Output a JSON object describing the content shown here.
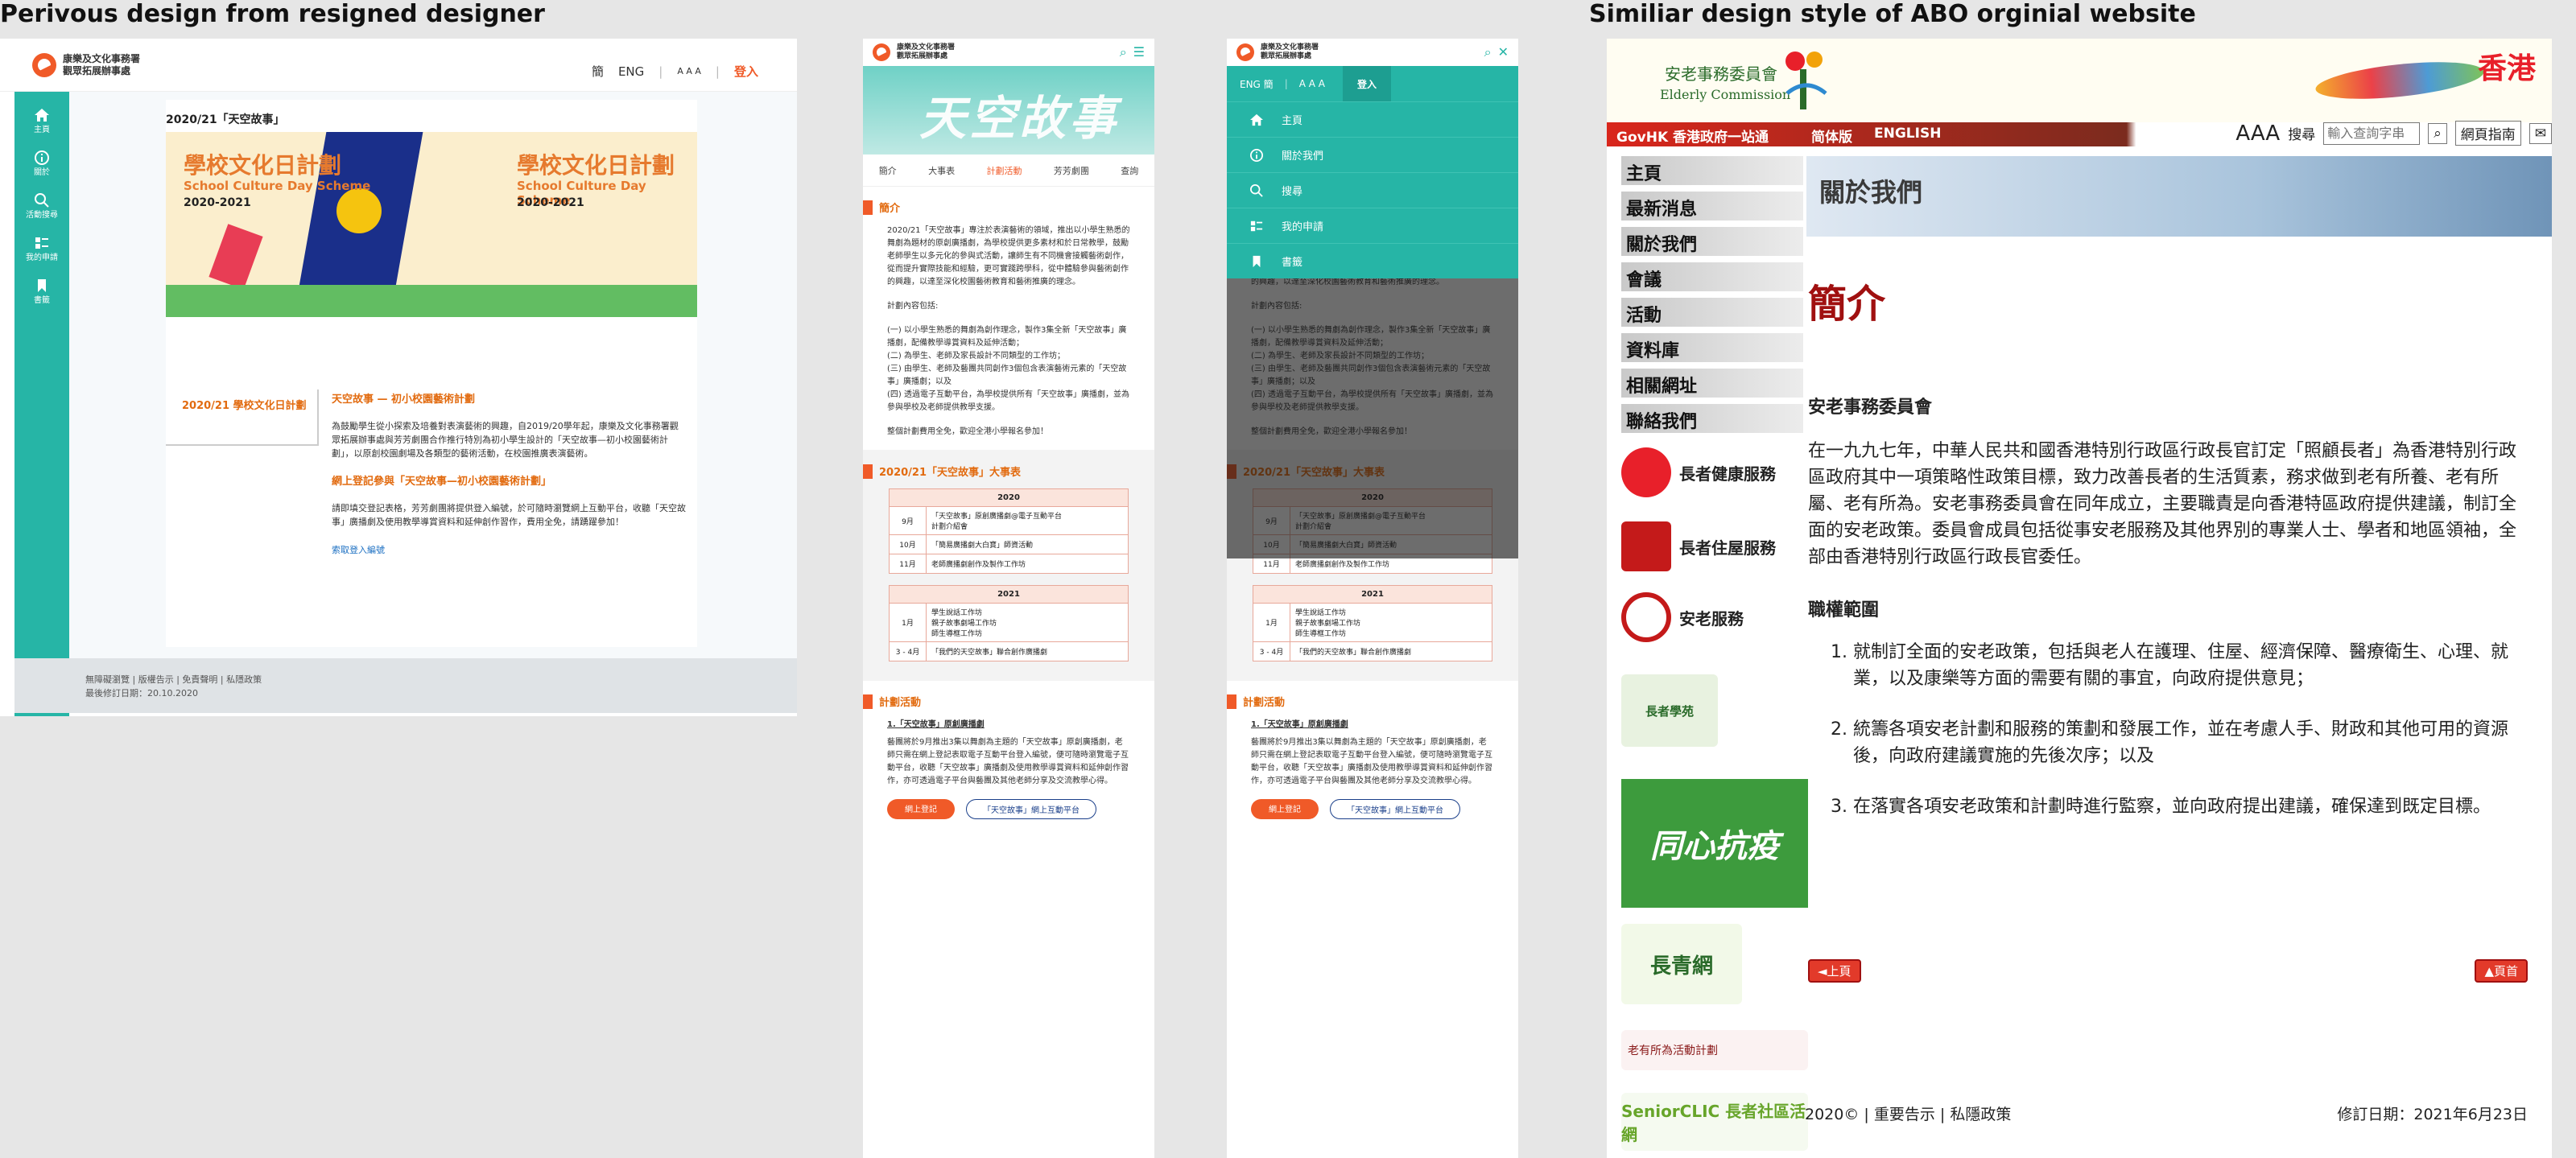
{
  "captions": {
    "left": "Perivous design from resigned designer",
    "right": "Similiar design style of ABO orginial website"
  },
  "desktop": {
    "logo_line1": "康樂及文化事務署",
    "logo_line2": "觀眾拓展辦事處",
    "lang_simplified": "簡",
    "lang_english": "ENG",
    "font_size": "A A A",
    "login": "登入",
    "nav": [
      {
        "label": "主頁",
        "icon": "home-icon"
      },
      {
        "label": "關於",
        "icon": "info-icon"
      },
      {
        "label": "活動搜尋",
        "icon": "search-icon"
      },
      {
        "label": "我的申請",
        "icon": "application-icon"
      },
      {
        "label": "書籤",
        "icon": "bookmark-icon"
      }
    ],
    "page_title": "2020/21「天空故事」",
    "banner": {
      "zh": "學校文化日計劃",
      "en": "School Culture Day Scheme",
      "year": "2020-2021"
    },
    "left_menu": "2020/21 學校文化日計劃",
    "article": {
      "heading": "天空故事 — 初小校園藝術計劃",
      "para1": "為鼓勵學生從小探索及培養對表演藝術的興趣，自2019/20學年起，康樂及文化事務署觀眾拓展辦事處與芳芳劇團合作推行特別為初小學生設計的「天空故事—初小校園藝術計劃」，以原創校園劇場及各類型的藝術活動，在校園推廣表演藝術。",
      "heading2": "網上登記參與「天空故事—初小校園藝術計劃」",
      "para2": "請即填交登記表格，芳芳劇團將提供登入編號，於可隨時瀏覽網上互動平台，收聽「天空故事」廣播劇及使用教學導賞資料和延伸創作習作，費用全免，請踴躍參加！",
      "link": "索取登入編號"
    },
    "footer_links": "無障礙瀏覽  |  版權告示  |  免責聲明  |  私隱政策",
    "footer_date": "最後修訂日期：20.10.2020"
  },
  "mobile": {
    "logo_line1": "康樂及文化事務署",
    "logo_line2": "觀眾拓展辦事處",
    "hero": "天空故事",
    "tabs": [
      "簡介",
      "大事表",
      "計劃活動",
      "芳芳劇團",
      "查詢"
    ],
    "intro_heading": "簡介",
    "intro_para": "2020/21「天空故事」專注於表演藝術的領域，推出以小學生熟悉的舞劇為題材的原創廣播劇，為學校提供更多素材和於日常教學，鼓勵老師學生以多元化的參與式活動，讓師生有不同機會接觸藝術創作，從而提升實際技能和經驗，更可實踐跨學科，從中體驗參與藝術創作的興趣，以達至深化校園藝術教育和藝術推廣的理念。",
    "plan_title": "計劃內容包括:",
    "plan_items": [
      "(一) 以小學生熟悉的舞劇為創作理念，製作3集全新「天空故事」廣播劇，配備教學導賞資料及延伸活動；",
      "(二) 為學生、老師及家長設計不同類型的工作坊；",
      "(三) 由學生、老師及藝團共同創作3個包含表演藝術元素的「天空故事」廣播劇；以及",
      "(四) 透過電子互動平台，為學校提供所有「天空故事」廣播劇，並為參與學校及老師提供教學支援。"
    ],
    "closing": "整個計劃費用全免，歡迎全港小學報名參加！",
    "schedule_heading": "2020/21「天空故事」大事表",
    "table1": {
      "year": "2020",
      "rows": [
        {
          "month": "9月",
          "items": [
            "「天空故事」原創廣播劇@電子互動平台",
            "計劃介紹會"
          ]
        },
        {
          "month": "10月",
          "items": [
            "「簡易廣播劇大白寶」師資活動"
          ]
        },
        {
          "month": "11月",
          "items": [
            "老師廣播劇創作及製作工作坊"
          ]
        }
      ]
    },
    "table2": {
      "year": "2021",
      "rows": [
        {
          "month": "1月",
          "items": [
            "學生說話工作坊",
            "親子故事劇場工作坊",
            "師生導框工作坊"
          ]
        },
        {
          "month": "3 - 4月",
          "items": [
            "「我們的天空故事」聯合創作廣播劇"
          ]
        }
      ]
    },
    "activity_heading": "計劃活動",
    "activity_sub": "1.「天空故事」原創廣播劇",
    "activity_para": "藝團將於9月推出3集以舞劇為主題的「天空故事」原創廣播劇，老師只需在網上登記表取電子互動平台登入編號，便可隨時瀏覽電子互動平台，收聽「天空故事」廣播劇及使用教學導賞資料和延伸創作習作，亦可透過電子平台與藝團及其他老師分享及交流教學心得。",
    "btn_register": "網上登記",
    "btn_platform": "「天空故事」網上互動平台",
    "menu": {
      "lang": "ENG  簡",
      "font": "A A A",
      "login": "登入",
      "items": [
        {
          "label": "主頁",
          "icon": "home-icon"
        },
        {
          "label": "關於我們",
          "icon": "info-icon"
        },
        {
          "label": "搜尋",
          "icon": "search-icon"
        },
        {
          "label": "我的申請",
          "icon": "application-icon"
        },
        {
          "label": "書籤",
          "icon": "bookmark-icon"
        }
      ]
    }
  },
  "abo": {
    "org_zh": "安老事務委員會",
    "org_en": "Elderly Commission",
    "hk": "香港",
    "govhk": "GovHK 香港政府一站通",
    "simplified": "简体版",
    "english": "ENGLISH",
    "font_size": "AAA",
    "search_label": "搜尋",
    "search_placeholder": "輸入查詢字串",
    "sitemap": "網頁指南",
    "nav": [
      "主頁",
      "最新消息",
      "關於我們",
      "會議",
      "活動",
      "資料庫",
      "相關網址",
      "聯絡我們"
    ],
    "side_logos": [
      "長者健康服務",
      "長者住屋服務",
      "安老服務",
      "長者學苑",
      "同心抗疫",
      "長青網",
      "老有所為活動計劃",
      "SeniorCLIC 長者社區活網"
    ],
    "page_banner": "關於我們",
    "h1": "簡介",
    "commission": "安老事務委員會",
    "intro": "在一九九七年，中華人民共和國香港特別行政區行政長官訂定「照顧長者」為香港特別行政區政府其中一項策略性政策目標，致力改善長者的生活質素，務求做到老有所養、老有所屬、老有所為。安老事務委員會在同年成立，主要職責是向香港特區政府提供建議，制訂全面的安老政策。委員會成員包括從事安老服務及其他界別的專業人士、學者和地區領袖，全部由香港特別行政區行政長官委任。",
    "tor_heading": "職權範圍",
    "tor": [
      "就制訂全面的安老政策，包括與老人在護理、住屋、經濟保障、醫療衛生、心理、就業，以及康樂等方面的需要有關的事宜，向政府提供意見；",
      "統籌各項安老計劃和服務的策劃和發展工作，並在考慮人手、財政和其他可用的資源後，向政府建議實施的先後次序；以及",
      "在落實各項安老政策和計劃時進行監察，並向政府提出建議，確保達到既定目標。"
    ],
    "prev": "◄上頁",
    "home": "▲頁首",
    "footer": "2020© | 重要告示 | 私隱政策",
    "revised": "修訂日期：2021年6月23日"
  }
}
